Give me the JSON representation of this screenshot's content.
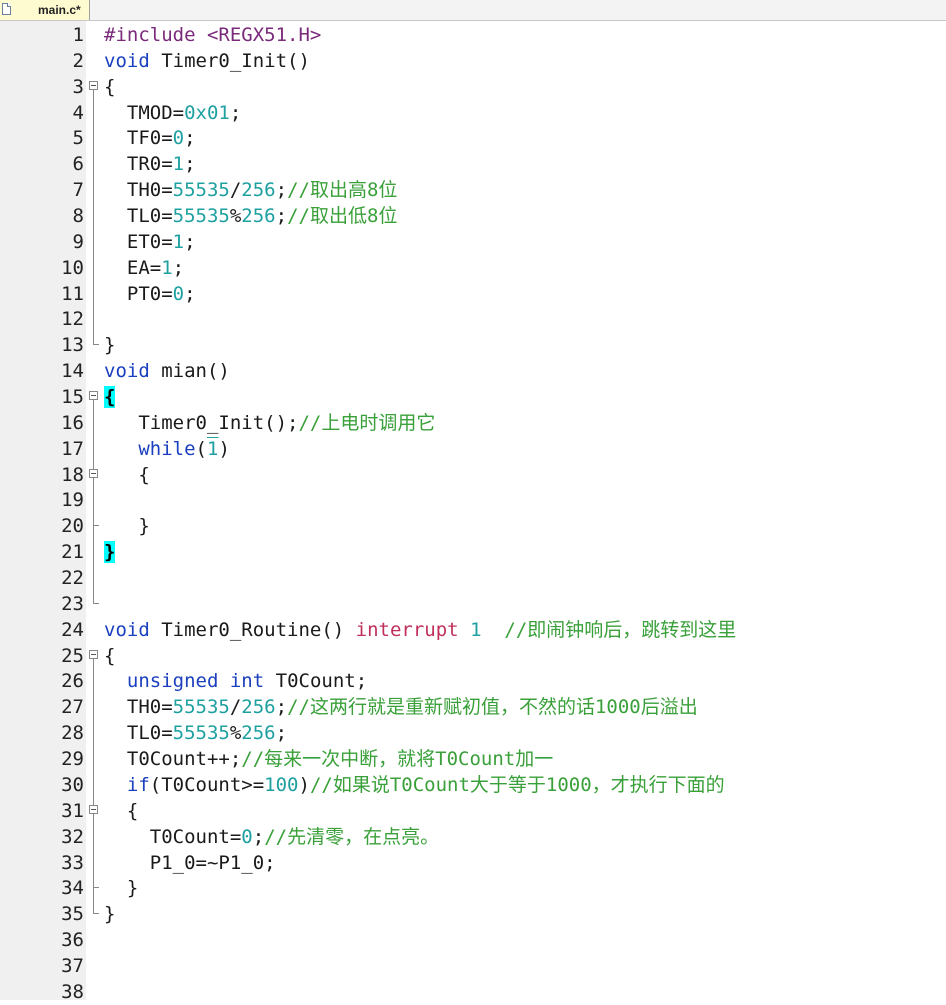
{
  "tab": {
    "label": "main.c*",
    "icon": "file-icon"
  },
  "colors": {
    "keyword": "#1a3fbf",
    "preprocessor": "#7a2a7a",
    "number": "#1fa0a0",
    "comment": "#3aa03a",
    "brace_highlight": "#00ffff"
  },
  "lines": [
    {
      "n": "1"
    },
    {
      "n": "2"
    },
    {
      "n": "3"
    },
    {
      "n": "4"
    },
    {
      "n": "5"
    },
    {
      "n": "6"
    },
    {
      "n": "7"
    },
    {
      "n": "8"
    },
    {
      "n": "9"
    },
    {
      "n": "10"
    },
    {
      "n": "11"
    },
    {
      "n": "12"
    },
    {
      "n": "13"
    },
    {
      "n": "14"
    },
    {
      "n": "15"
    },
    {
      "n": "16"
    },
    {
      "n": "17"
    },
    {
      "n": "18"
    },
    {
      "n": "19"
    },
    {
      "n": "20"
    },
    {
      "n": "21"
    },
    {
      "n": "22"
    },
    {
      "n": "23"
    },
    {
      "n": "24"
    },
    {
      "n": "25"
    },
    {
      "n": "26"
    },
    {
      "n": "27"
    },
    {
      "n": "28"
    },
    {
      "n": "29"
    },
    {
      "n": "30"
    },
    {
      "n": "31"
    },
    {
      "n": "32"
    },
    {
      "n": "33"
    },
    {
      "n": "34"
    },
    {
      "n": "35"
    },
    {
      "n": "36"
    },
    {
      "n": "37"
    },
    {
      "n": "38"
    }
  ],
  "code": {
    "l1": [
      "#include <REGX51.H>"
    ],
    "l2": [
      "void",
      " Timer0_Init()"
    ],
    "l3": [
      "{"
    ],
    "l4": [
      "  TMOD=",
      "0x01",
      ";"
    ],
    "l5": [
      "  TF0=",
      "0",
      ";"
    ],
    "l6": [
      "  TR0=",
      "1",
      ";"
    ],
    "l7": [
      "  TH0=",
      "55535",
      "/",
      "256",
      ";",
      "//取出高8位"
    ],
    "l8": [
      "  TL0=",
      "55535",
      "%",
      "256",
      ";",
      "//取出低8位"
    ],
    "l9": [
      "  ET0=",
      "1",
      ";"
    ],
    "l10": [
      "  EA=",
      "1",
      ";"
    ],
    "l11": [
      "  PT0=",
      "0",
      ";"
    ],
    "l13": [
      "}"
    ],
    "l14": [
      "void",
      " mian()"
    ],
    "l15": [
      "{"
    ],
    "l16": [
      "   Timer0_Init();",
      "//上电时调用它"
    ],
    "l17": [
      "   ",
      "while",
      "(",
      "1",
      ")"
    ],
    "l18": [
      "   {"
    ],
    "l20": [
      "   }"
    ],
    "l21": [
      "}"
    ],
    "l24": [
      "void",
      " Timer0_Routine() ",
      "interrupt",
      " ",
      "1",
      "  ",
      "//即闹钟响后，跳转到这里"
    ],
    "l25": [
      "{"
    ],
    "l26": [
      "  ",
      "unsigned",
      " ",
      "int",
      " T0Count;"
    ],
    "l27": [
      "  TH0=",
      "55535",
      "/",
      "256",
      ";",
      "//这两行就是重新赋初值，不然的话1000后溢出"
    ],
    "l28": [
      "  TL0=",
      "55535",
      "%",
      "256",
      ";"
    ],
    "l29": [
      "  T0Count++;",
      "//每来一次中断，就将T0Count加一"
    ],
    "l30": [
      "  ",
      "if",
      "(T0Count>=",
      "100",
      ")",
      "//如果说T0Count大于等于1000，才执行下面的"
    ],
    "l31": [
      "  {"
    ],
    "l32": [
      "    T0Count=",
      "0",
      ";",
      "//先清零，在点亮。"
    ],
    "l33": [
      "    P1_0=~P1_0;"
    ],
    "l34": [
      "  }"
    ],
    "l35": [
      "}"
    ]
  }
}
